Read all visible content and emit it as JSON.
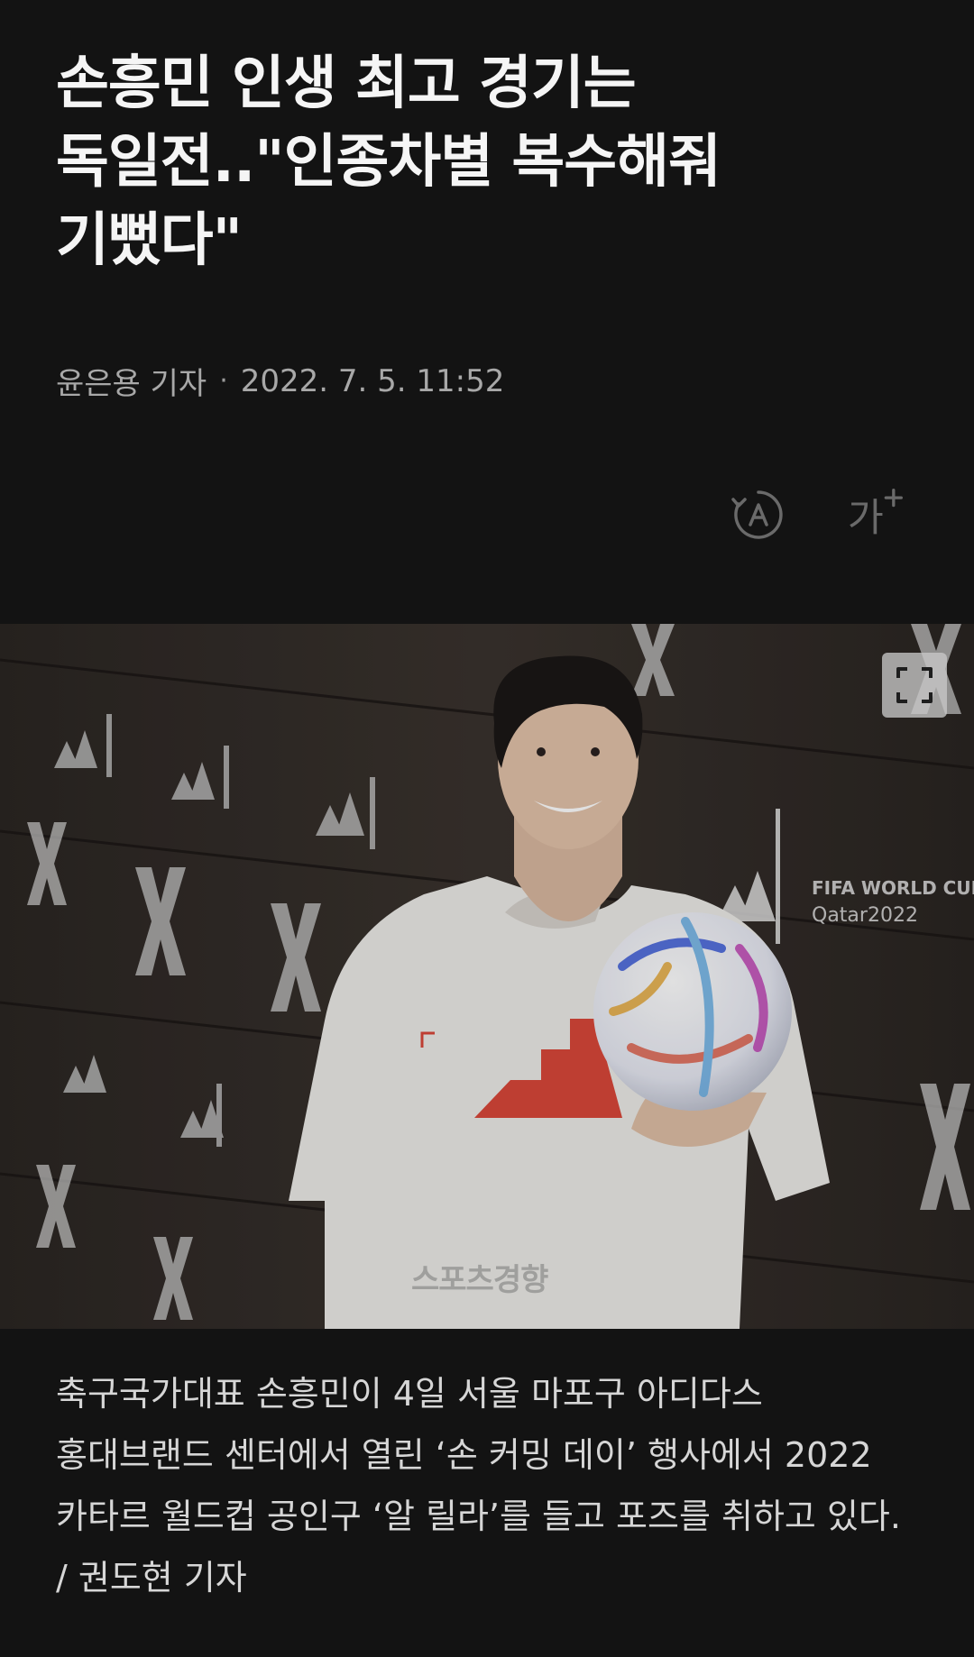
{
  "article": {
    "headline": "손흥민 인생 최고 경기는 독일전..\"인종차별 복수해줘 기뻤다\"",
    "reporter": "윤은용 기자",
    "date": "2022. 7. 5. 11:52"
  },
  "toolbar": {
    "translate_icon": "translate-icon",
    "fontsize_label": "가",
    "fontsize_icon": "font-size-icon"
  },
  "photo": {
    "watermark": "스포츠경향",
    "fullscreen_icon": "fullscreen-icon"
  },
  "caption": "축구국가대표 손흥민이 4일 서울 마포구 아디다스 홍대브랜드 센터에서 열린 ‘손 커밍 데이’ 행사에서 2022 카타르 월드컵 공인구 ‘알 릴라’를 들고 포즈를 취하고 있다. / 권도현 기자",
  "colors": {
    "background": "#131313",
    "headline": "#f5f5f5",
    "meta": "#a8a8a8",
    "logo_red": "#d9473a"
  }
}
